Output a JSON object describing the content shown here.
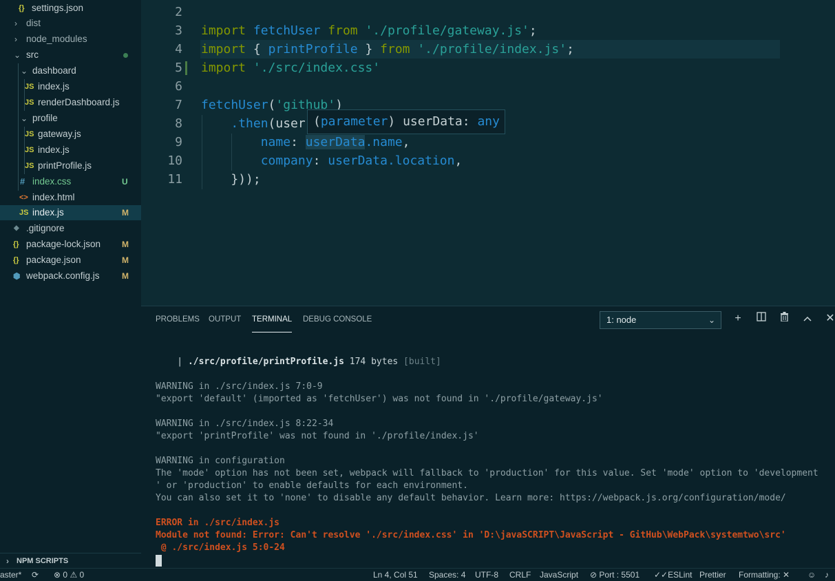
{
  "explorer": {
    "items": [
      {
        "label": "settings.json",
        "icon": "{}",
        "badge": ""
      },
      {
        "label": "dist",
        "icon": "",
        "badge": ""
      },
      {
        "label": "node_modules",
        "icon": "",
        "badge": ""
      },
      {
        "label": "src",
        "icon": "",
        "badge": ""
      },
      {
        "label": "dashboard",
        "icon": "",
        "badge": ""
      },
      {
        "label": "index.js",
        "icon": "JS",
        "badge": ""
      },
      {
        "label": "renderDashboard.js",
        "icon": "JS",
        "badge": ""
      },
      {
        "label": "profile",
        "icon": "",
        "badge": ""
      },
      {
        "label": "gateway.js",
        "icon": "JS",
        "badge": ""
      },
      {
        "label": "index.js",
        "icon": "JS",
        "badge": ""
      },
      {
        "label": "printProfile.js",
        "icon": "JS",
        "badge": ""
      },
      {
        "label": "index.css",
        "icon": "#",
        "badge": "U"
      },
      {
        "label": "index.html",
        "icon": "<>",
        "badge": ""
      },
      {
        "label": "index.js",
        "icon": "JS",
        "badge": "M"
      },
      {
        "label": ".gitignore",
        "icon": "◆",
        "badge": ""
      },
      {
        "label": "package-lock.json",
        "icon": "{}",
        "badge": "M"
      },
      {
        "label": "package.json",
        "icon": "{}",
        "badge": "M"
      },
      {
        "label": "webpack.config.js",
        "icon": "⬢",
        "badge": "M"
      }
    ],
    "npm_scripts": "NPM SCRIPTS"
  },
  "editor": {
    "line_numbers": [
      "2",
      "3",
      "4",
      "5",
      "6",
      "7",
      "8",
      "9",
      "10",
      "11"
    ],
    "code": {
      "l3_kw": "import",
      "l3_id": "fetchUser",
      "l3_from": "from",
      "l3_str": "'./profile/gateway.js'",
      "l3_end": ";",
      "l4_kw": "import",
      "l4_open": "{ ",
      "l4_id": "printProfile",
      "l4_close": " }",
      "l4_from": "from",
      "l4_str": "'./profile/index.js'",
      "l4_end": ";",
      "l5_kw": "import",
      "l5_str": "'./src/index.css'",
      "l7_id": "fetchUser",
      "l7_open": "(",
      "l7_str": "'github'",
      "l7_close": ")",
      "l8_id": ".then",
      "l8_rest": "(user",
      "l9_key": "name",
      "l9_sep": ": ",
      "l9_obj": "userData",
      "l9_prop": ".name",
      "l9_end": ",",
      "l10_key": "company",
      "l10_sep": ": ",
      "l10_obj": "userData",
      "l10_prop": ".location",
      "l10_end": ",",
      "l11": "}));"
    },
    "hover": {
      "open": "(",
      "param": "parameter",
      "close": ")",
      "name": " userData",
      "colon": ": ",
      "type": "any"
    }
  },
  "panel": {
    "tabs": [
      "PROBLEMS",
      "OUTPUT",
      "TERMINAL",
      "DEBUG CONSOLE"
    ],
    "active_tab": "TERMINAL",
    "terminal_select": "1: node",
    "terminal": {
      "l1_prefix": "    | ",
      "l1_file": "./src/profile/printProfile.js",
      "l1_size": " 174 bytes ",
      "l1_built": "[built]",
      "w1_head": "WARNING in ./src/index.js 7:0-9",
      "w1_msg": "\"export 'default' (imported as 'fetchUser') was not found in './profile/gateway.js'",
      "w2_head": "WARNING in ./src/index.js 8:22-34",
      "w2_msg": "\"export 'printProfile' was not found in './profile/index.js'",
      "w3_head": "WARNING in configuration",
      "w3_l1": "The 'mode' option has not been set, webpack will fallback to 'production' for this value. Set 'mode' option to 'development",
      "w3_l2": "' or 'production' to enable defaults for each environment.",
      "w3_l3": "You can also set it to 'none' to disable any default behavior. Learn more: https://webpack.js.org/configuration/mode/",
      "e_head": "ERROR in ./src/index.js",
      "e_msg": "Module not found: Error: Can't resolve './src/index.css' in 'D:\\javaSCRIPT\\JavaScript - GitHub\\WebPack\\systemtwo\\src'",
      "e_at": " @ ./src/index.js 5:0-24"
    }
  },
  "statusbar": {
    "branch": "aster*",
    "errors": "0",
    "warnings": "0",
    "position": "Ln 4, Col 51",
    "spaces": "Spaces: 4",
    "encoding": "UTF-8",
    "eol": "CRLF",
    "language": "JavaScript",
    "port": "Port : 5501",
    "eslint": "ESLint",
    "prettier": "Prettier",
    "formatting": "Formatting: ✕"
  },
  "colors": {
    "background": "#0d2b33",
    "sidebar": "#0a2129",
    "keyword": "#859900",
    "string": "#2aa198",
    "identifier": "#268bd2",
    "error": "#d0501f",
    "js_icon": "#cbcb41",
    "json_icon": "#cbcb41",
    "css_file": "#73c991",
    "html_icon": "#e37933",
    "webpack_icon": "#519aba"
  }
}
